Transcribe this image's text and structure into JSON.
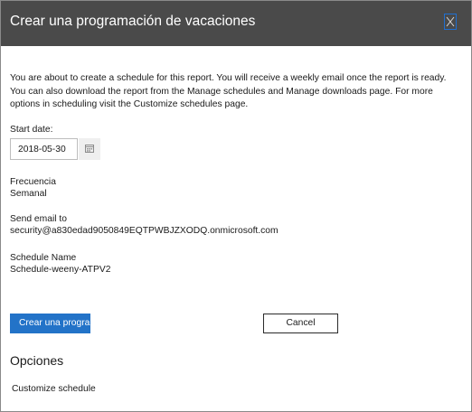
{
  "dialog": {
    "title": "Crear una programación de vacaciones",
    "close_icon": "close-icon"
  },
  "intro_text": "You are about to create a schedule for this report. You will receive a weekly email once the report is ready. You can also download the report from the Manage schedules and Manage downloads page. For more options in scheduling visit the Customize schedules page.",
  "start_date": {
    "label": "Start date:",
    "value": "2018-05-30",
    "calendar_icon": "calendar-icon"
  },
  "frequency": {
    "label": "Frecuencia",
    "value": "Semanal"
  },
  "email": {
    "label": "Send email to",
    "value": "security@a830edad9050849EQTPWBJZXODQ.onmicrosoft.com"
  },
  "schedule_name": {
    "label": "Schedule Name",
    "value": "Schedule-weeny-ATPV2"
  },
  "buttons": {
    "create_label": "Crear una program",
    "cancel_label": "Cancel"
  },
  "options": {
    "heading": "Opciones",
    "customize_label": "Customize schedule"
  },
  "colors": {
    "header_bg": "#4a4a4a",
    "primary": "#2373c8"
  }
}
